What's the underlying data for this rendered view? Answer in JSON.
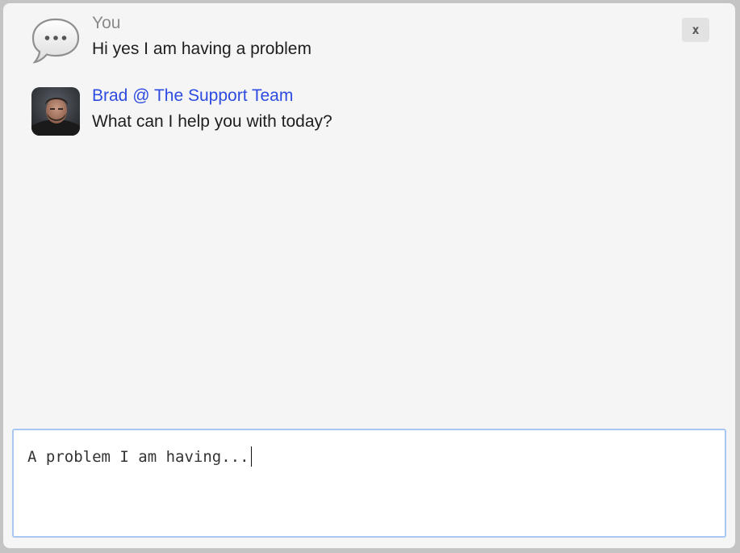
{
  "close_button": {
    "label": "x"
  },
  "messages": [
    {
      "sender": "You",
      "text": "Hi yes I am having a problem",
      "avatar_icon": "speech-bubble-icon",
      "sender_color": "#8a8a8a"
    },
    {
      "sender": "Brad @ The Support Team",
      "text": "What can I help you with today?",
      "avatar_icon": "profile-photo",
      "sender_color": "#2d4be0"
    }
  ],
  "composer": {
    "value": "A problem I am having...",
    "border_color": "#a9c7f2"
  },
  "colors": {
    "window_background": "#f5f5f5",
    "page_background": "#c4c4c4",
    "link_blue": "#2d4be0"
  }
}
